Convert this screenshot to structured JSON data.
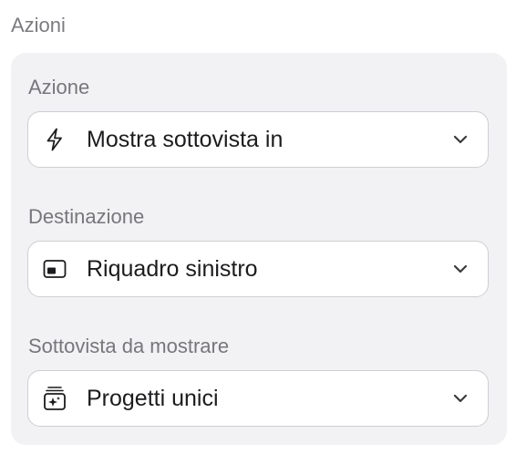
{
  "section": {
    "title": "Azioni"
  },
  "fields": [
    {
      "label": "Azione",
      "value": "Mostra sottovista in",
      "icon": "lightning-bolt-icon"
    },
    {
      "label": "Destinazione",
      "value": "Riquadro sinistro",
      "icon": "left-pane-icon"
    },
    {
      "label": "Sottovista da mostrare",
      "value": "Progetti unici",
      "icon": "sparkle-stack-icon"
    }
  ],
  "colors": {
    "panel_bg": "#f2f2f4",
    "label": "#77777b",
    "text": "#1c1c1e",
    "border": "#cfcfd3"
  }
}
